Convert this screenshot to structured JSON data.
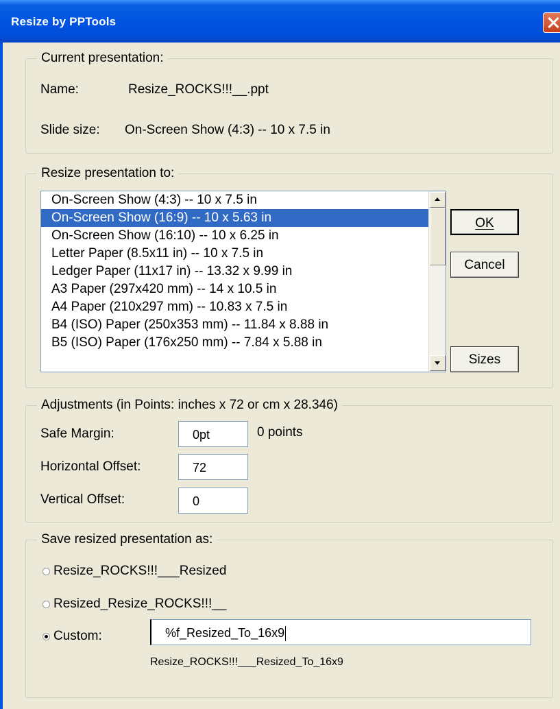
{
  "window": {
    "title": "Resize by PPTools"
  },
  "current": {
    "legend": "Current presentation:",
    "name_label": "Name:",
    "name_value": "Resize_ROCKS!!!__.ppt",
    "size_label": "Slide size:",
    "size_value": "On-Screen Show (4:3) -- 10 x 7.5 in"
  },
  "resize": {
    "legend": "Resize presentation to:",
    "options": [
      "On-Screen Show (4:3) -- 10 x 7.5 in",
      "On-Screen Show (16:9) -- 10 x 5.63 in",
      "On-Screen Show (16:10) -- 10 x 6.25 in",
      "Letter Paper (8.5x11 in) -- 10 x 7.5 in",
      "Ledger Paper (11x17 in) -- 13.32 x 9.99 in",
      "A3 Paper (297x420 mm) -- 14 x 10.5 in",
      "A4 Paper (210x297 mm) -- 10.83 x 7.5 in",
      "B4 (ISO) Paper (250x353 mm) -- 11.84 x 8.88 in",
      "B5 (ISO) Paper (176x250 mm) -- 7.84 x 5.88 in"
    ],
    "selected_index": 1,
    "ok_label": "OK",
    "cancel_label": "Cancel",
    "sizes_label": "Sizes"
  },
  "adjust": {
    "legend": "Adjustments (in Points: inches x 72 or cm x 28.346)",
    "safe_margin_label": "Safe Margin:",
    "safe_margin_value": "0pt",
    "safe_margin_note": "0 points",
    "h_offset_label": "Horizontal Offset:",
    "h_offset_value": "72",
    "v_offset_label": "Vertical Offset:",
    "v_offset_value": "0"
  },
  "save": {
    "legend": "Save resized presentation as:",
    "option1": "Resize_ROCKS!!!___Resized",
    "option2": "Resized_Resize_ROCKS!!!__",
    "option3": "Custom:",
    "selected": "custom",
    "custom_value": "%f_Resized_To_16x9",
    "preview": "Resize_ROCKS!!!___Resized_To_16x9"
  },
  "colors": {
    "titlebar": "#0054e3",
    "selection": "#316ac5",
    "dialog_bg": "#ece9d8"
  }
}
